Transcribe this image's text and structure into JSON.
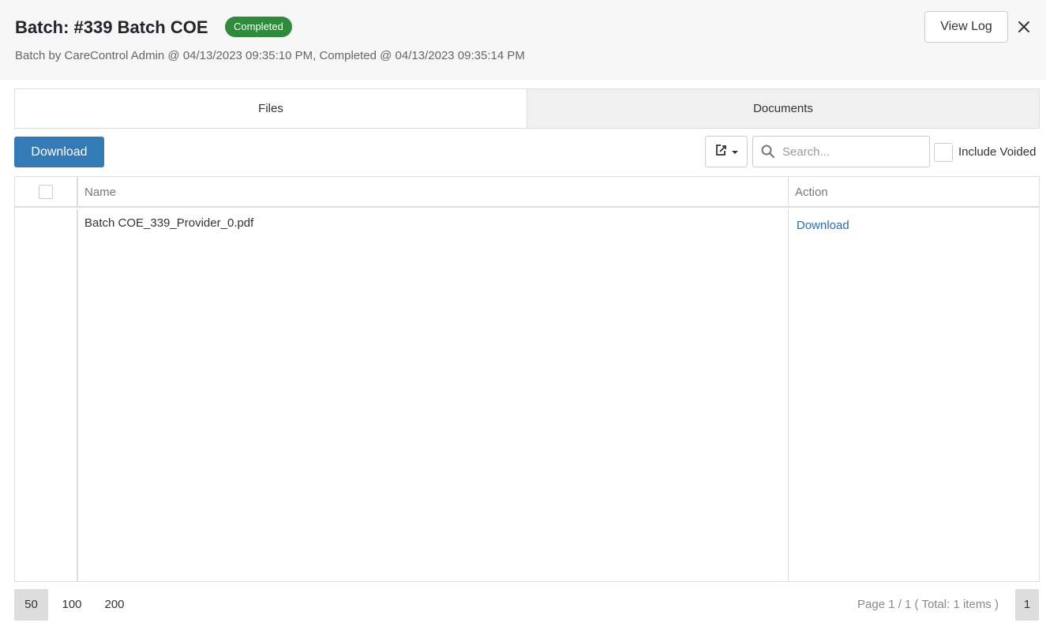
{
  "header": {
    "title": "Batch: #339 Batch COE",
    "status": "Completed",
    "subtitle": "Batch by CareControl Admin @ 04/13/2023 09:35:10 PM, Completed @ 04/13/2023 09:35:14 PM",
    "view_log_label": "View Log",
    "close_icon": "close-icon"
  },
  "colors": {
    "status_badge": "#2f8a3c",
    "primary_button": "#337ab7",
    "link": "#2a6bb3"
  },
  "tabs": [
    {
      "label": "Files",
      "active": true
    },
    {
      "label": "Documents",
      "active": false
    }
  ],
  "toolbar": {
    "download_label": "Download",
    "export_icon": "export-icon",
    "search_placeholder": "Search...",
    "include_voided_label": "Include Voided"
  },
  "grid": {
    "columns": [
      "Name",
      "Action"
    ],
    "rows": [
      {
        "name": "Batch COE_339_Provider_0.pdf",
        "action": "Download"
      }
    ]
  },
  "pager": {
    "page_sizes": [
      "50",
      "100",
      "200"
    ],
    "active_size": "50",
    "info": "Page 1 / 1 ( Total: 1 items )",
    "current_page": "1"
  }
}
